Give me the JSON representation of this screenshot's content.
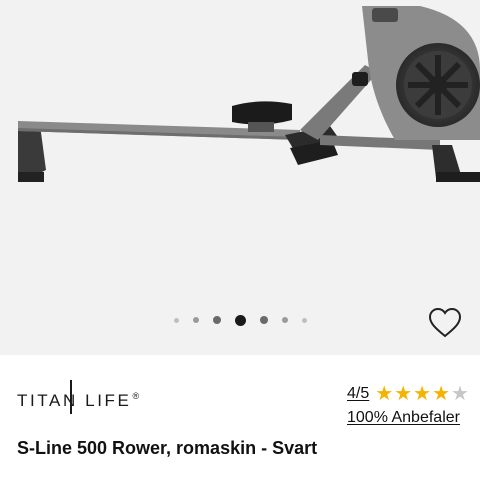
{
  "gallery": {
    "image_alt": "S-Line 500 Rower",
    "slide_count": 7,
    "active_slide": 4
  },
  "brand": {
    "name": "TITAN LIFE",
    "trademark": "®"
  },
  "rating": {
    "score_text": "4/5",
    "stars": 4,
    "max_stars": 5,
    "star_color": "#f5b301",
    "empty_star_color": "#c7c7c7",
    "recommend_text": "100% Anbefaler"
  },
  "product": {
    "title": "S-Line 500 Rower, romaskin - Svart"
  },
  "icons": {
    "favorite": "heart-outline-icon"
  }
}
